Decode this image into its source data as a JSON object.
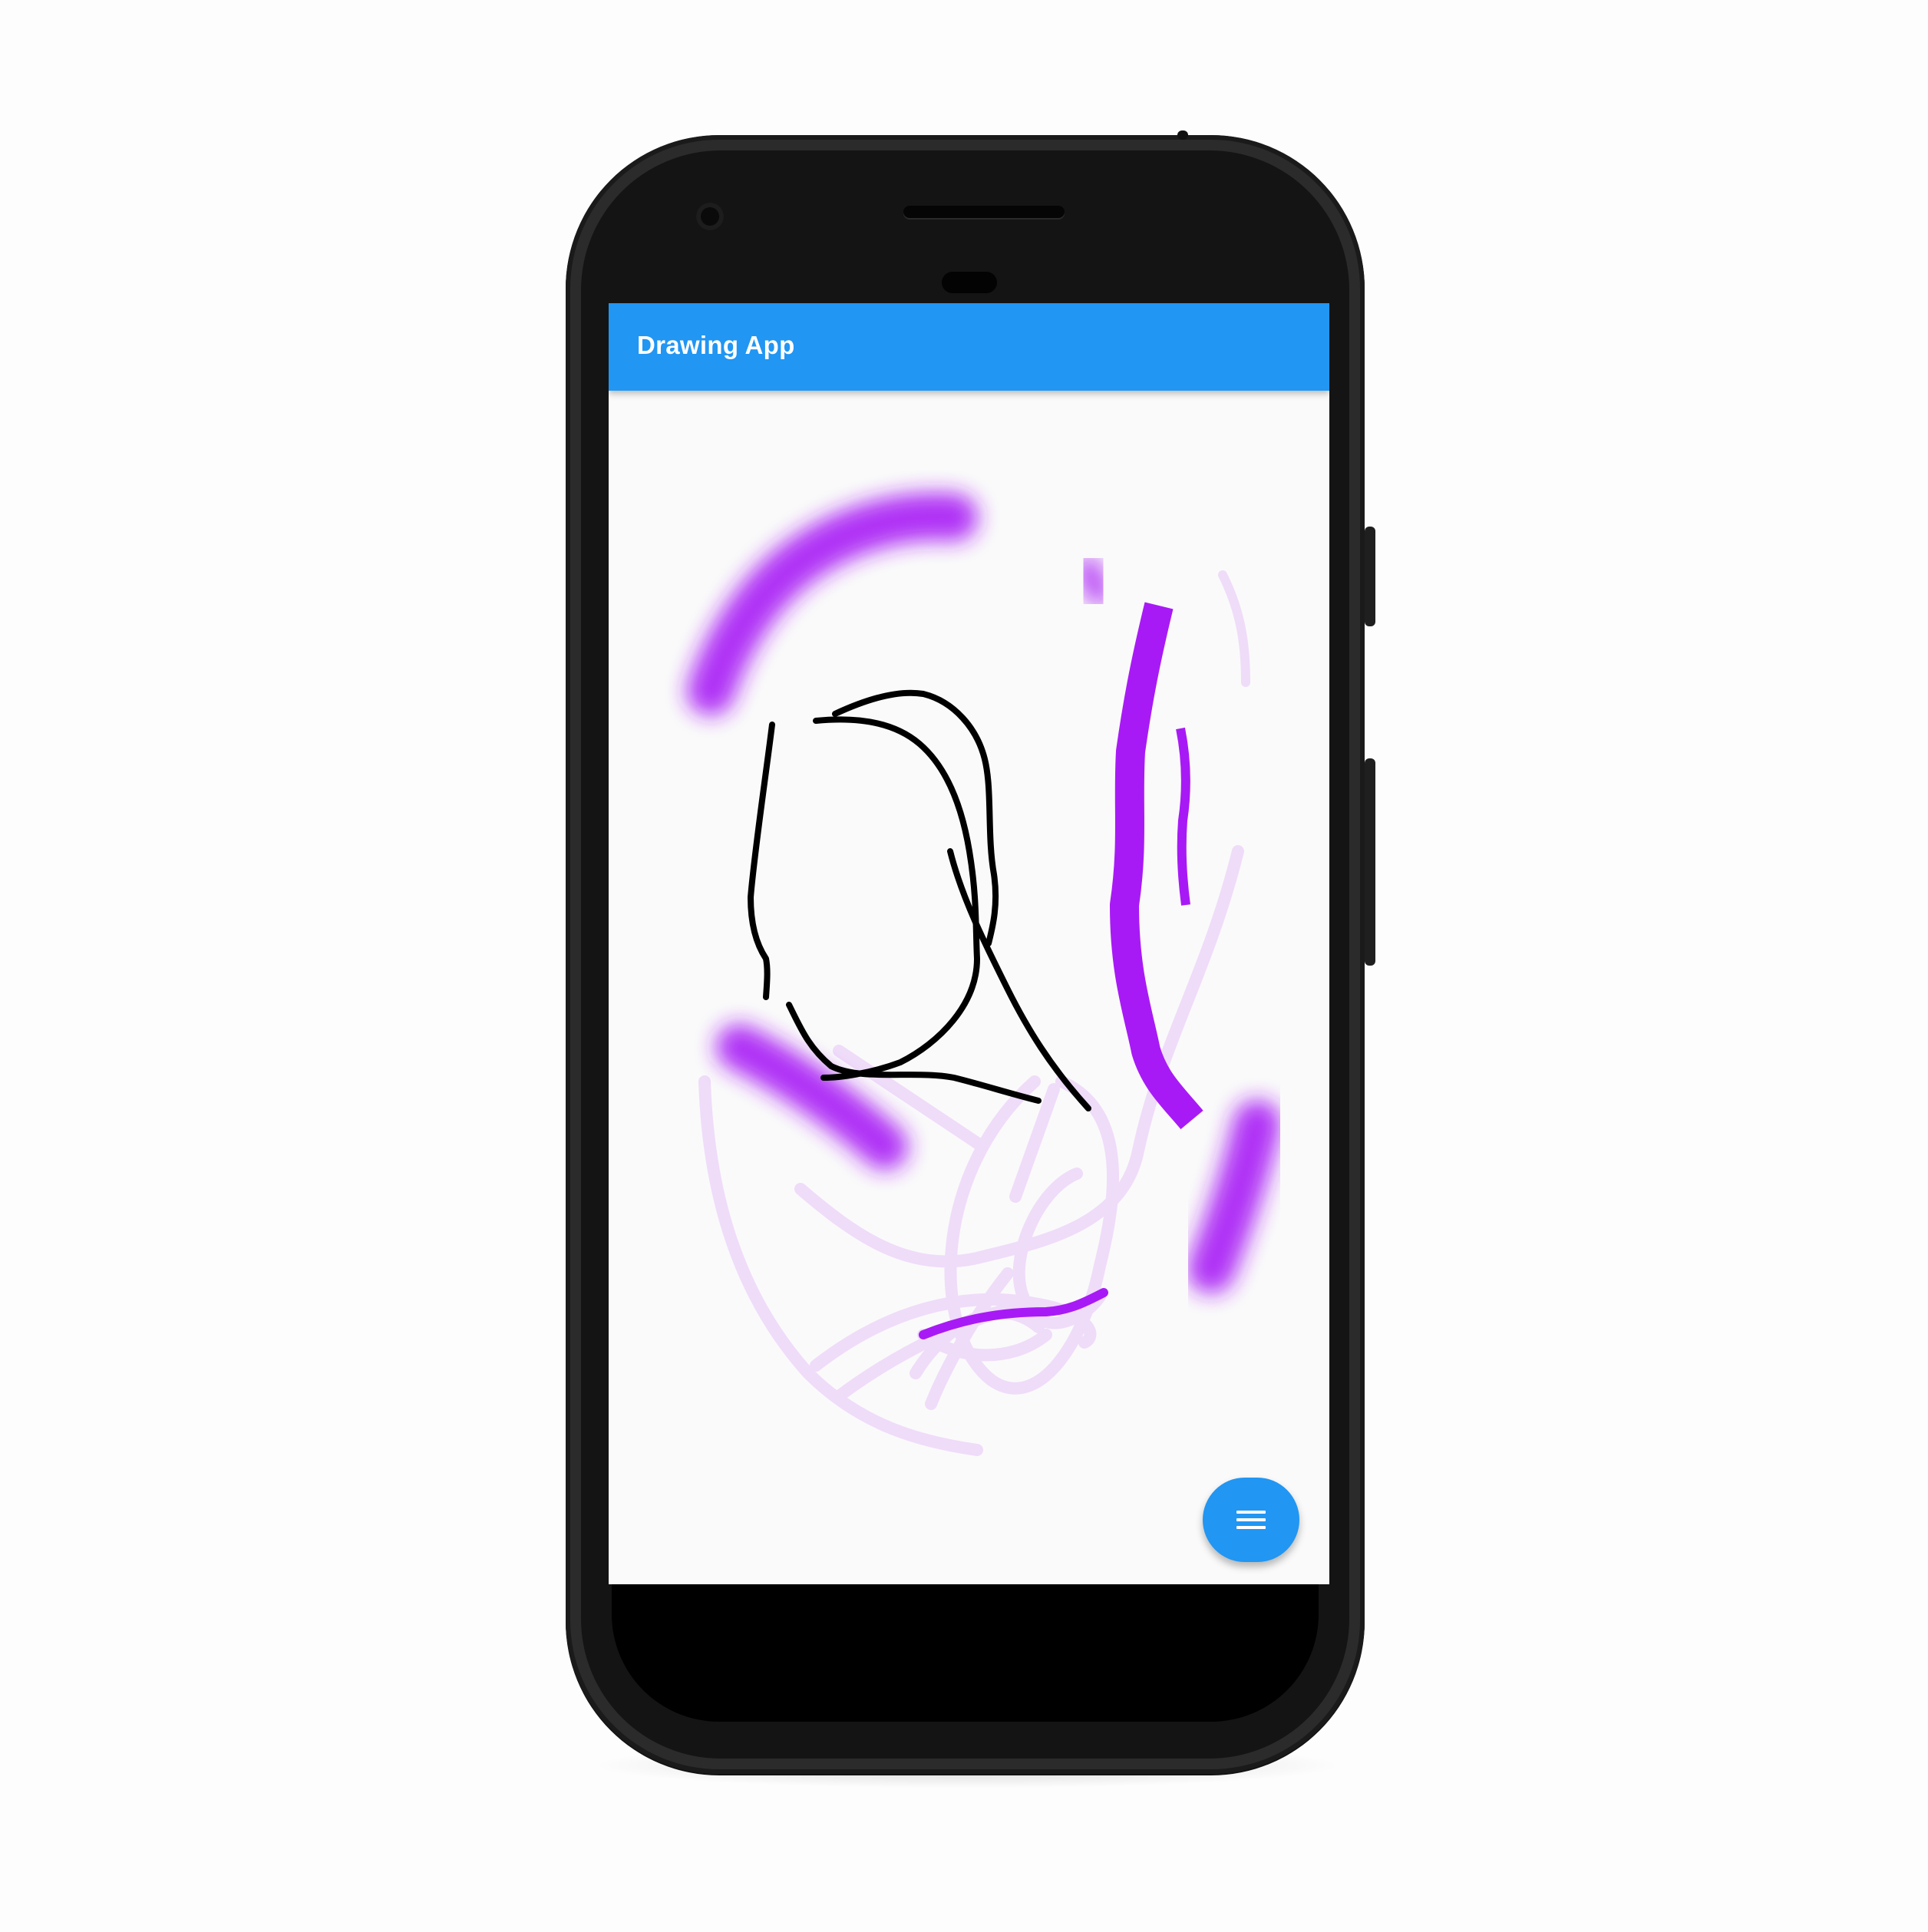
{
  "app_bar": {
    "title": "Drawing App",
    "color": "#2196f3"
  },
  "canvas": {
    "background": "#fafafa",
    "stroke_colors": {
      "black": "#000000",
      "purple": "#a81af5"
    }
  },
  "fab": {
    "icon": "menu-icon",
    "color": "#2196f3"
  }
}
